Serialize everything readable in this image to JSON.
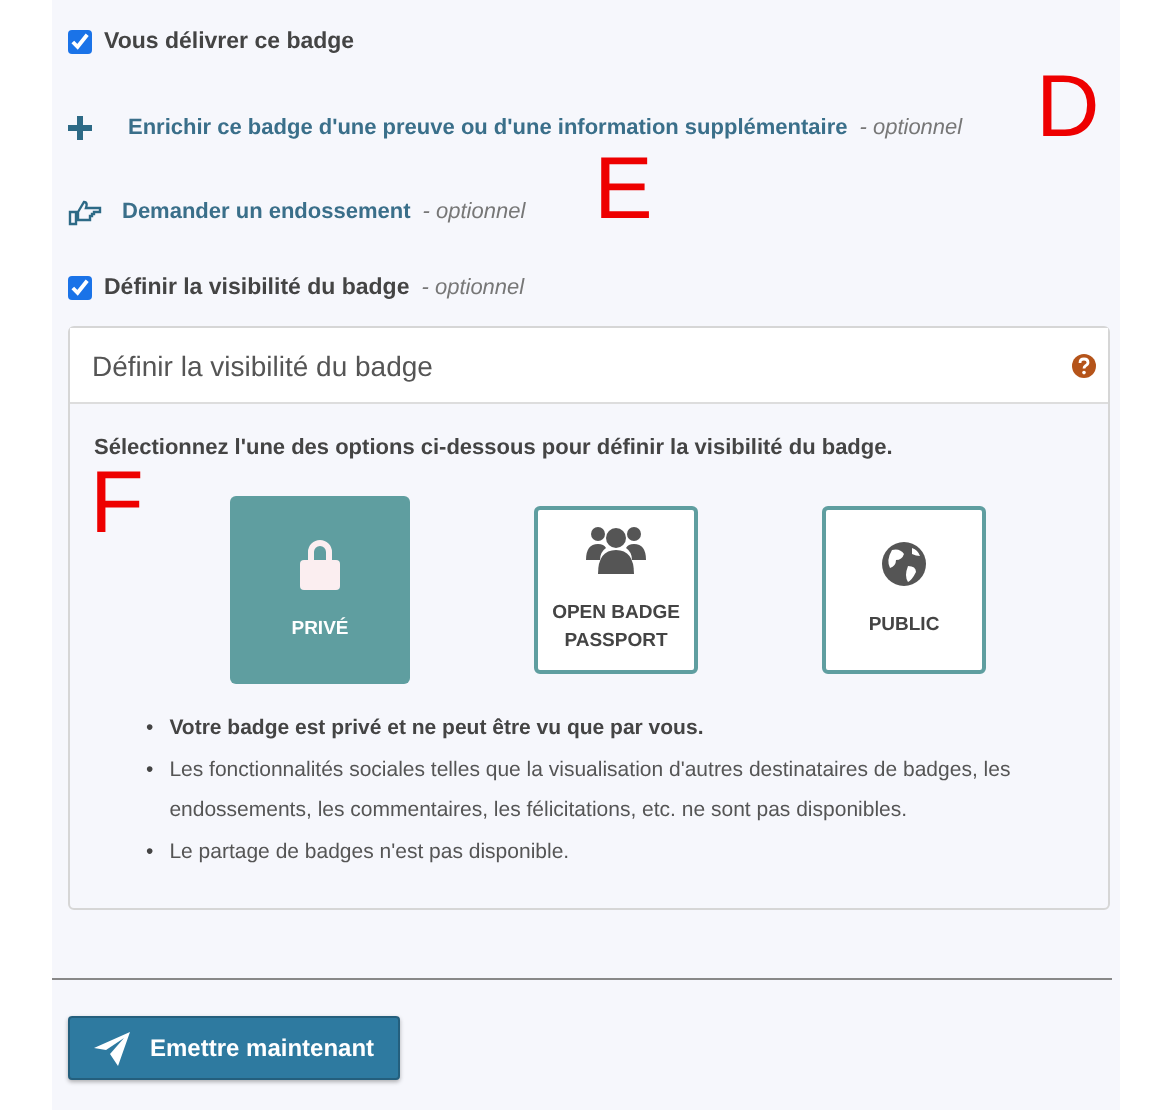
{
  "items": [
    {
      "kind": "checkbox",
      "label": "Vous délivrer ce badge",
      "checked": true
    },
    {
      "kind": "add-link",
      "label": "Enrichir ce badge d'une preuve ou d'une information supplémentaire",
      "suffix": "- optionnel"
    },
    {
      "kind": "endorse-link",
      "label": "Demander un endossement",
      "suffix": "- optionnel"
    },
    {
      "kind": "checkbox",
      "label": "Définir la visibilité du badge",
      "suffix": "- optionnel",
      "checked": true
    }
  ],
  "visibility_panel": {
    "title": "Définir la visibilité du badge",
    "intro": "Sélectionnez l'une des options ci-dessous pour définir la visibilité du badge.",
    "options": [
      {
        "label": "PRIVÉ",
        "selected": true
      },
      {
        "label": "OPEN BADGE PASSPORT",
        "selected": false
      },
      {
        "label": "PUBLIC",
        "selected": false
      }
    ],
    "notes": [
      {
        "bullet": "•",
        "text": "Votre badge est privé et ne peut être vu que par vous.",
        "bold": true
      },
      {
        "bullet": "•",
        "text": "Les fonctionnalités sociales telles que la visualisation d'autres destinataires de badges, les endossements, les commentaires, les félicitations, etc. ne sont pas disponibles.",
        "bold": false
      },
      {
        "bullet": "•",
        "text": "Le partage de badges n'est pas disponible.",
        "bold": false
      }
    ]
  },
  "submit_button": {
    "label": "Emettre maintenant"
  },
  "annotations": [
    "D",
    "E",
    "F"
  ]
}
